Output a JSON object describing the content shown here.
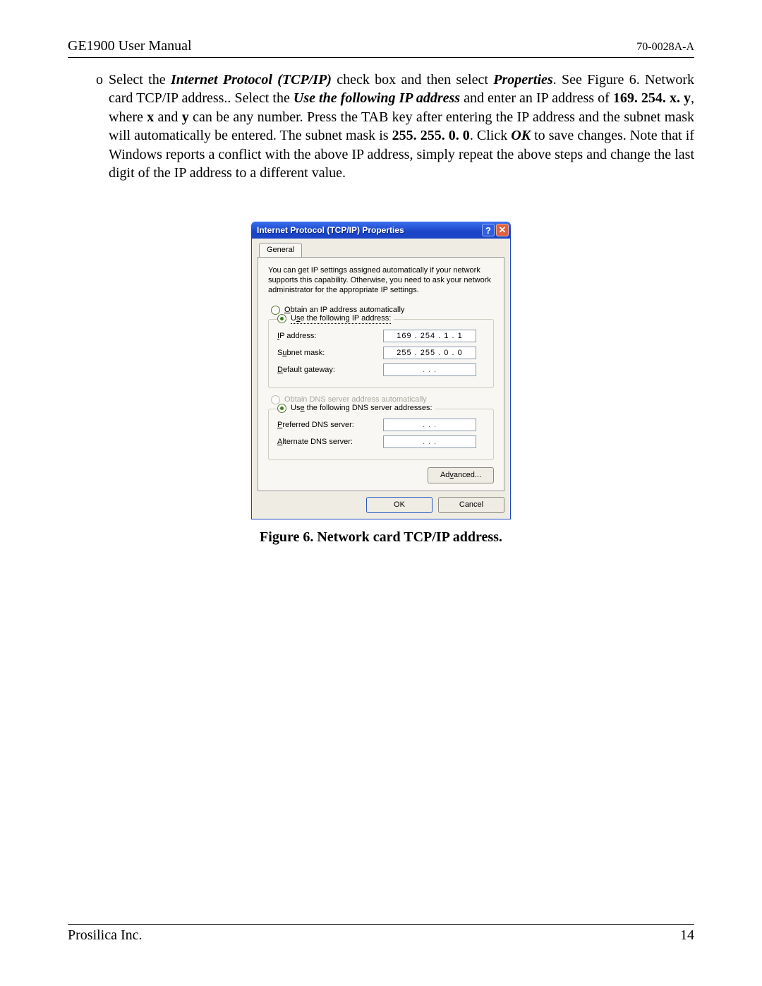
{
  "header": {
    "left": "GE1900 User Manual",
    "right": "70-0028A-A"
  },
  "bullet": "o",
  "para": {
    "p1a": "Select the ",
    "p1b": "Internet Protocol (TCP/IP)",
    "p1c": " check box and then select ",
    "p1d": "Properties",
    "p1e": ". See Figure 6. Network card TCP/IP address.. Select the ",
    "p1f": "Use the following IP address",
    "p1g": " and enter an IP address of ",
    "p1h": "169. 254. x. y",
    "p1i": ", where ",
    "p1j": "x",
    "p1k": " and ",
    "p1l": "y",
    "p1m": " can be any number. Press the TAB key after entering the IP address and the subnet mask will automatically be entered. The subnet mask is ",
    "p1n": "255. 255. 0. 0",
    "p1o": ".  Click ",
    "p1p": "OK",
    "p1q": " to save changes.  Note that if Windows reports a conflict with the above IP address, simply repeat the above steps and change the last digit of the IP address to a different value."
  },
  "dialog": {
    "title": "Internet Protocol (TCP/IP) Properties",
    "tab": "General",
    "desc": "You can get IP settings assigned automatically if your network supports this capability. Otherwise, you need to ask your network administrator for the appropriate IP settings.",
    "radio_auto_ip": "Obtain an IP address automatically",
    "radio_use_ip": "Use the following IP address:",
    "lbl_ip": "IP address:",
    "lbl_subnet": "Subnet mask:",
    "lbl_gateway": "Default gateway:",
    "val_ip": "169 . 254 .  1  .  1",
    "val_subnet": "255 . 255 .  0  .  0",
    "val_gateway": " .       .       . ",
    "radio_auto_dns": "Obtain DNS server address automatically",
    "radio_use_dns": "Use the following DNS server addresses:",
    "lbl_pref_dns": "Preferred DNS server:",
    "lbl_alt_dns": "Alternate DNS server:",
    "val_pref_dns": " .       .       . ",
    "val_alt_dns": " .       .       . ",
    "btn_advanced": "Advanced...",
    "btn_ok": "OK",
    "btn_cancel": "Cancel"
  },
  "caption": "Figure 6.  Network card TCP/IP address.",
  "footer": {
    "left": "Prosilica Inc.",
    "right": "14"
  }
}
